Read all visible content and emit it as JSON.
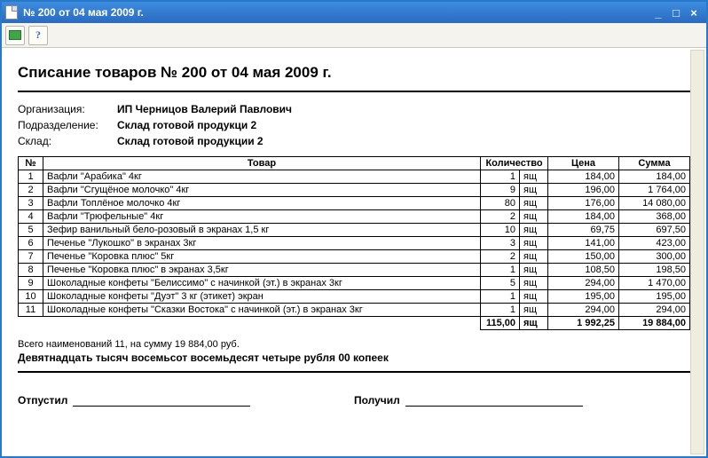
{
  "window": {
    "title": "№ 200 от 04 мая 2009 г."
  },
  "document": {
    "title": "Списание товаров № 200 от 04 мая 2009 г.",
    "meta": {
      "org_label": "Организация:",
      "org_value": "ИП Черницов Валерий Павлович",
      "dept_label": "Подразделение:",
      "dept_value": "Склад готовой продукци 2",
      "store_label": "Склад:",
      "store_value": "Склад готовой продукции 2"
    },
    "headers": {
      "num": "№",
      "product": "Товар",
      "qty": "Количество",
      "price": "Цена",
      "sum": "Сумма"
    },
    "rows": [
      {
        "n": "1",
        "name": "Вафли \"Арабика\" 4кг",
        "qty": "1",
        "unit": "ящ",
        "price": "184,00",
        "sum": "184,00"
      },
      {
        "n": "2",
        "name": "Вафли \"Сгущёное молочко\" 4кг",
        "qty": "9",
        "unit": "ящ",
        "price": "196,00",
        "sum": "1 764,00"
      },
      {
        "n": "3",
        "name": "Вафли   Топлёное молочко  4кг",
        "qty": "80",
        "unit": "ящ",
        "price": "176,00",
        "sum": "14 080,00"
      },
      {
        "n": "4",
        "name": "Вафли \"Трюфельные\" 4кг",
        "qty": "2",
        "unit": "ящ",
        "price": "184,00",
        "sum": "368,00"
      },
      {
        "n": "5",
        "name": "Зефир ванильный бело-розовый в экранах 1,5 кг",
        "qty": "10",
        "unit": "ящ",
        "price": "69,75",
        "sum": "697,50"
      },
      {
        "n": "6",
        "name": "Печенье \"Лукошко\" в экранах 3кг",
        "qty": "3",
        "unit": "ящ",
        "price": "141,00",
        "sum": "423,00"
      },
      {
        "n": "7",
        "name": "Печенье \"Коровка плюс\" 5кг",
        "qty": "2",
        "unit": "ящ",
        "price": "150,00",
        "sum": "300,00"
      },
      {
        "n": "8",
        "name": "Печенье \"Коровка плюс\" в экранах 3,5кг",
        "qty": "1",
        "unit": "ящ",
        "price": "108,50",
        "sum": "198,50"
      },
      {
        "n": "9",
        "name": "Шоколадные конфеты \"Белиссимо\" с начинкой (эт.)  в экранах 3кг",
        "qty": "5",
        "unit": "ящ",
        "price": "294,00",
        "sum": "1 470,00"
      },
      {
        "n": "10",
        "name": "Шоколадные конфеты \"Дуэт\"  3 кг (этикет) экран",
        "qty": "1",
        "unit": "ящ",
        "price": "195,00",
        "sum": "195,00"
      },
      {
        "n": "11",
        "name": "Шоколадные конфеты \"Сказки Востока\" с начинкой (эт.)  в экранах 3кг",
        "qty": "1",
        "unit": "ящ",
        "price": "294,00",
        "sum": "294,00"
      }
    ],
    "totals": {
      "qty": "115,00",
      "unit": "ящ",
      "price": "1 992,25",
      "sum": "19 884,00"
    },
    "summary_line": "Всего наименований 11, на сумму 19 884,00 руб.",
    "summary_words": "Девятнадцать тысяч восемьсот восемьдесят четыре рубля 00 копеек",
    "sig_left": "Отпустил",
    "sig_right": "Получил"
  }
}
